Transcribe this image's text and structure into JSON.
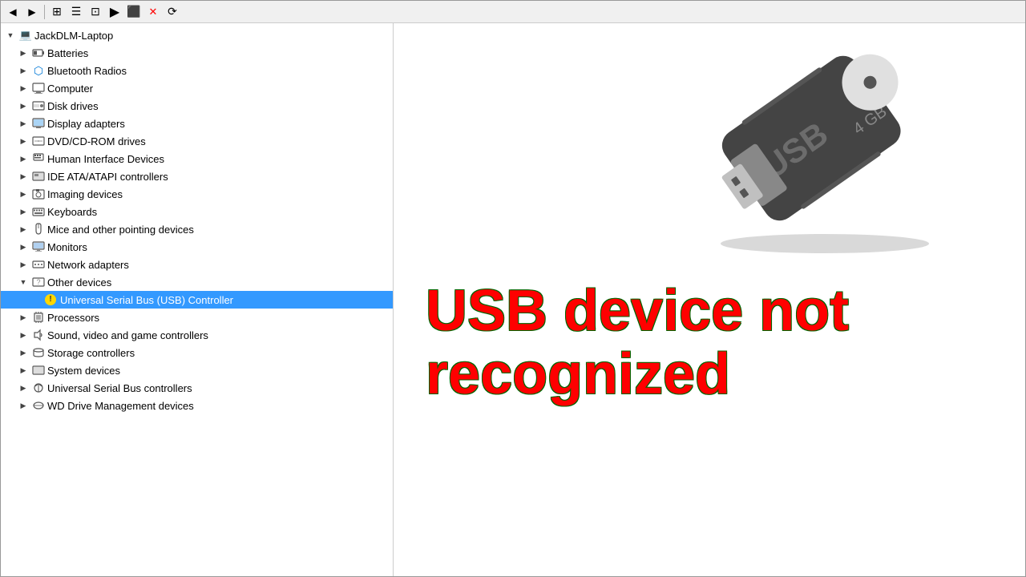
{
  "toolbar": {
    "buttons": [
      "←",
      "→",
      "⊡",
      "≡",
      "⬚",
      "▶",
      "⬛",
      "✕",
      "→"
    ]
  },
  "tree": {
    "root": {
      "label": "JackDLM-Laptop",
      "expanded": true
    },
    "items": [
      {
        "id": "batteries",
        "label": "Batteries",
        "indent": 1,
        "expanded": false,
        "icon": "🔋"
      },
      {
        "id": "bluetooth",
        "label": "Bluetooth Radios",
        "indent": 1,
        "expanded": false,
        "icon": "🔵"
      },
      {
        "id": "computer",
        "label": "Computer",
        "indent": 1,
        "expanded": false,
        "icon": "🖥️"
      },
      {
        "id": "diskdrives",
        "label": "Disk drives",
        "indent": 1,
        "expanded": false,
        "icon": "💾"
      },
      {
        "id": "displayadapters",
        "label": "Display adapters",
        "indent": 1,
        "expanded": false,
        "icon": "🖥️"
      },
      {
        "id": "dvdcdrom",
        "label": "DVD/CD-ROM drives",
        "indent": 1,
        "expanded": false,
        "icon": "💿"
      },
      {
        "id": "hid",
        "label": "Human Interface Devices",
        "indent": 1,
        "expanded": false,
        "icon": "🖱️"
      },
      {
        "id": "ideata",
        "label": "IDE ATA/ATAPI controllers",
        "indent": 1,
        "expanded": false,
        "icon": "⚙️"
      },
      {
        "id": "imaging",
        "label": "Imaging devices",
        "indent": 1,
        "expanded": false,
        "icon": "📷"
      },
      {
        "id": "keyboards",
        "label": "Keyboards",
        "indent": 1,
        "expanded": false,
        "icon": "⌨️"
      },
      {
        "id": "mice",
        "label": "Mice and other pointing devices",
        "indent": 1,
        "expanded": false,
        "icon": "🖱️"
      },
      {
        "id": "monitors",
        "label": "Monitors",
        "indent": 1,
        "expanded": false,
        "icon": "🖥️"
      },
      {
        "id": "networkadapters",
        "label": "Network adapters",
        "indent": 1,
        "expanded": false,
        "icon": "🌐"
      },
      {
        "id": "otherdevices",
        "label": "Other devices",
        "indent": 1,
        "expanded": true,
        "icon": "❓"
      },
      {
        "id": "usb_controller",
        "label": "Universal Serial Bus (USB) Controller",
        "indent": 2,
        "expanded": false,
        "icon": "⚠️",
        "selected": true
      },
      {
        "id": "processors",
        "label": "Processors",
        "indent": 1,
        "expanded": false,
        "icon": "⚙️"
      },
      {
        "id": "soundvideo",
        "label": "Sound, video and game controllers",
        "indent": 1,
        "expanded": false,
        "icon": "🔊"
      },
      {
        "id": "storage",
        "label": "Storage controllers",
        "indent": 1,
        "expanded": false,
        "icon": "💾"
      },
      {
        "id": "systemdevices",
        "label": "System devices",
        "indent": 1,
        "expanded": false,
        "icon": "⚙️"
      },
      {
        "id": "usbcontrollers",
        "label": "Universal Serial Bus controllers",
        "indent": 1,
        "expanded": false,
        "icon": "🔌"
      },
      {
        "id": "wdrive",
        "label": "WD Drive Management devices",
        "indent": 1,
        "expanded": false,
        "icon": "💾"
      }
    ]
  },
  "message": {
    "line1": "USB device not",
    "line2": "recognized"
  }
}
